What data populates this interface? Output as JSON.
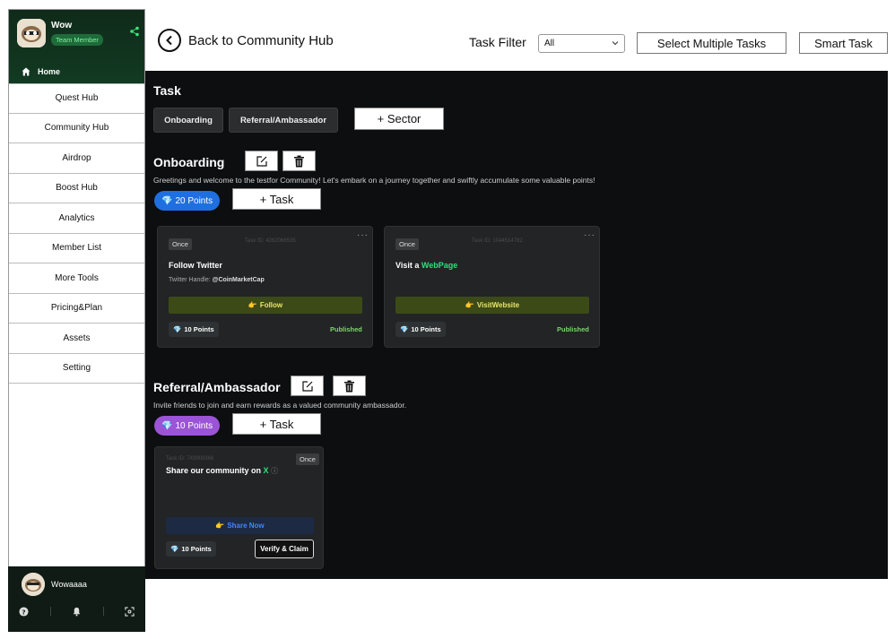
{
  "sidebar": {
    "user_name": "Wow",
    "role": "Team Member",
    "home_label": "Home",
    "items": [
      {
        "label": "Quest Hub"
      },
      {
        "label": "Community Hub"
      },
      {
        "label": "Airdrop"
      },
      {
        "label": "Boost Hub"
      },
      {
        "label": "Analytics"
      },
      {
        "label": "Member List"
      },
      {
        "label": "More Tools"
      },
      {
        "label": "Pricing&Plan"
      },
      {
        "label": "Assets"
      },
      {
        "label": "Setting"
      }
    ],
    "bottom_user": "Wowaaaa",
    "bottom_icons": [
      "help-icon",
      "bell-icon",
      "scan-icon"
    ]
  },
  "header": {
    "back_label": "Back to Community Hub",
    "filter_label": "Task Filter",
    "filter_value": "All",
    "select_multiple_label": "Select Multiple Tasks",
    "smart_task_label": "Smart Task"
  },
  "main": {
    "task_heading": "Task",
    "tabs": [
      {
        "label": "Onboarding"
      },
      {
        "label": "Referral/Ambassador"
      }
    ],
    "add_sector_label": "+ Sector",
    "sectors": [
      {
        "title": "Onboarding",
        "description": "Greetings and welcome to the testfor Community! Let's embark on a journey together and swiftly accumulate some valuable points!",
        "points": "20 Points",
        "add_task_label": "+ Task",
        "cards": [
          {
            "frequency": "Once",
            "task_id": "Task ID: 4262066535",
            "title": "Follow Twitter",
            "sub_label": "Twitter Handle:",
            "sub_value": "@CoinMarketCap",
            "action": "Follow",
            "points": "10 Points",
            "status": "Published"
          },
          {
            "frequency": "Once",
            "task_id": "Task ID: 1044514782",
            "title_prefix": "Visit a",
            "title_link": "WebPage",
            "action": "VisitWebsite",
            "points": "10 Points",
            "status": "Published"
          }
        ]
      },
      {
        "title": "Referral/Ambassador",
        "description": "Invite friends to join and earn rewards as a valued community ambassador.",
        "points": "10 Points",
        "add_task_label": "+ Task",
        "cards": [
          {
            "frequency": "Once",
            "task_id": "Task ID: 743908366",
            "title_prefix": "Share our community on",
            "title_link": "X",
            "action": "Share Now",
            "points": "10 Points",
            "button": "Verify & Claim"
          }
        ]
      }
    ]
  },
  "colors": {
    "main_bg": "#0c0e0f",
    "sidebar_top": "#123a22",
    "blue_pill": "#1f6fe0",
    "purple_pill": "#9b54d6",
    "follow_bar": "#3c4a17",
    "follow_text": "#e9e36a",
    "share_bar": "#1d2a44",
    "share_text": "#3f86ff",
    "link_green": "#2fe07a",
    "status_green": "#7bd66a"
  }
}
